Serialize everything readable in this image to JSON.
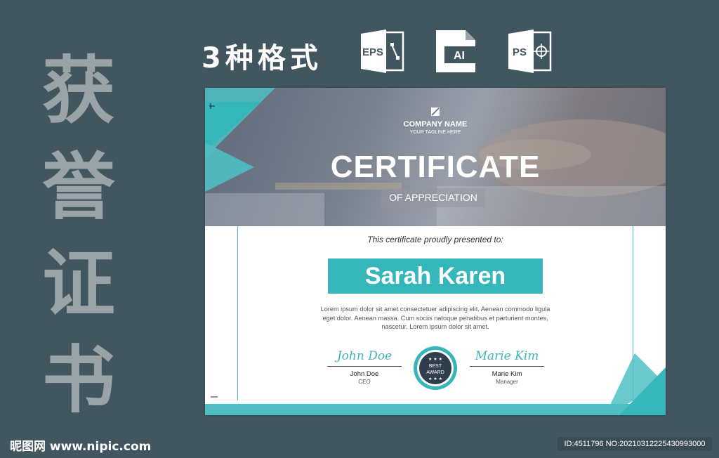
{
  "side_title": [
    "获",
    "誉",
    "证",
    "书"
  ],
  "formats": {
    "label": "3种格式",
    "icons": [
      {
        "name": "eps-file-icon",
        "text": "EPS"
      },
      {
        "name": "ai-file-icon",
        "text": "AI"
      },
      {
        "name": "ps-file-icon",
        "text": "PS"
      }
    ]
  },
  "certificate": {
    "company_name": "COMPANY NAME",
    "tagline": "YOUR TAGLINE HERE",
    "title": "CERTIFICATE",
    "subtitle": "OF APPRECIATION",
    "presented": "This certificate proudly presented to:",
    "recipient": "Sarah Karen",
    "body_lines": [
      "Lorem ipsum dolor sit amet consectetuer adipiscing elit. Aenean commodo ligula",
      "eget dolor. Aenean massa. Cum sociis natoque penatibus et parturient montes,",
      "nascetur. Lorem ipsum dolor sit amet."
    ],
    "badge": {
      "line1": "BEST",
      "line2": "AWARD"
    },
    "signers": [
      {
        "script": "John Doe",
        "name": "John Doe",
        "role": "CEO"
      },
      {
        "script": "Marie Kim",
        "name": "Marie Kim",
        "role": "Manager"
      }
    ]
  },
  "footer": {
    "left": "昵图网 www.nipic.com",
    "right": "ID:4511796 NO:20210312225430993000"
  },
  "colors": {
    "background": "#425660",
    "accent": "#35b6bb",
    "side_text": "#9aa4a8"
  }
}
